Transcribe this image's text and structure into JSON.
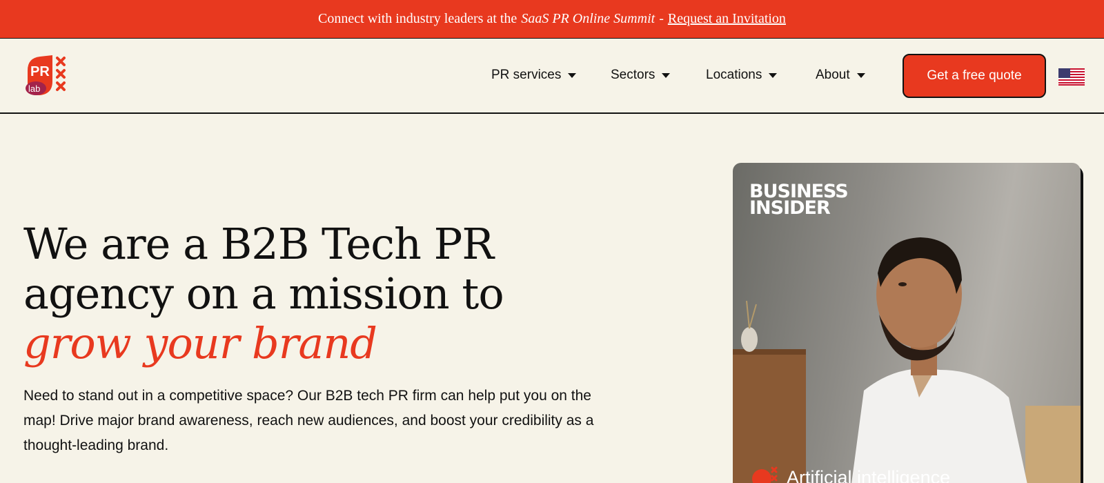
{
  "announcement": {
    "lead": "Connect with industry leaders at the",
    "event": "SaaS PR Online Summit",
    "separator": "-",
    "link": "Request an Invitation"
  },
  "header": {
    "logo": {
      "text_top": "PR",
      "text_bottom": "lab"
    },
    "nav": [
      {
        "label": "PR services"
      },
      {
        "label": "Sectors"
      },
      {
        "label": "Locations"
      },
      {
        "label": "About"
      }
    ],
    "cta": "Get a free quote",
    "language_icon": "us-flag-icon"
  },
  "hero": {
    "headline_line1": "We are a B2B Tech PR",
    "headline_line2": "agency on a mission to",
    "headline_accent": "grow your brand",
    "body": "Need to stand out in a competitive space? Our B2B tech PR firm can help put you on the map! Drive major brand awareness, reach new audiences, and boost your credibility as a thought-leading brand."
  },
  "card": {
    "publication_line1": "BUSINESS",
    "publication_line2": "INSIDER",
    "caption": "Artificial intelligence"
  },
  "colors": {
    "accent": "#e8391f",
    "background": "#f6f3e8",
    "text": "#111111"
  }
}
